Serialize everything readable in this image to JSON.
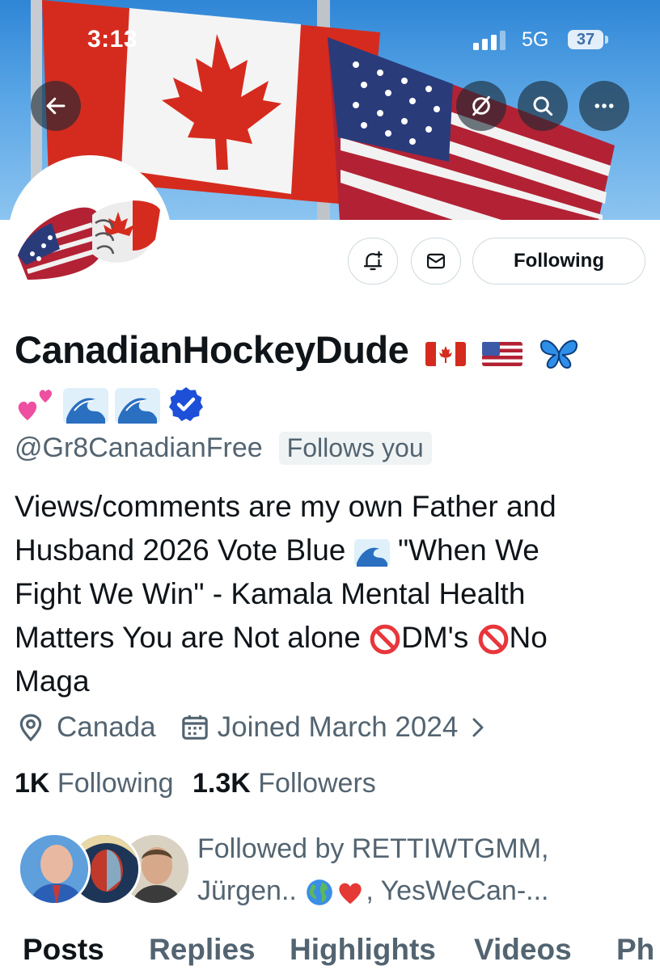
{
  "status": {
    "time": "3:13",
    "network": "5G",
    "battery": "37"
  },
  "profile": {
    "display_name": "CanadianHockeyDude",
    "handle": "@Gr8CanadianFree",
    "follows_you": "Follows you",
    "verified": true,
    "bio_lines": [
      "Views/comments are my own Father and",
      "Husband 2026 Vote Blue",
      "\"When We",
      "Fight We Win\" - Kamala Mental Health",
      "Matters You are Not alone",
      "DM's",
      "No",
      "Maga"
    ],
    "location": "Canada",
    "joined": "Joined March 2024",
    "following_count": "1K",
    "following_label": "Following",
    "followers_count": "1.3K",
    "followers_label": "Followers",
    "followed_by_line1": "Followed by RETTIWTGMM,",
    "followed_by_line2a": "Jürgen..",
    "followed_by_line2b": ", YesWeCan-..."
  },
  "buttons": {
    "following": "Following"
  },
  "tabs": [
    "Posts",
    "Replies",
    "Highlights",
    "Videos",
    "Ph"
  ],
  "icons": {
    "back": "back-arrow-icon",
    "grok": "grok-icon",
    "search": "search-icon",
    "more": "more-icon",
    "notify": "bell-plus-icon",
    "message": "envelope-icon",
    "location": "location-pin-icon",
    "calendar": "calendar-icon"
  },
  "colors": {
    "verified": "#1d9bf0",
    "text": "#0f1419",
    "secondary": "#536471"
  }
}
